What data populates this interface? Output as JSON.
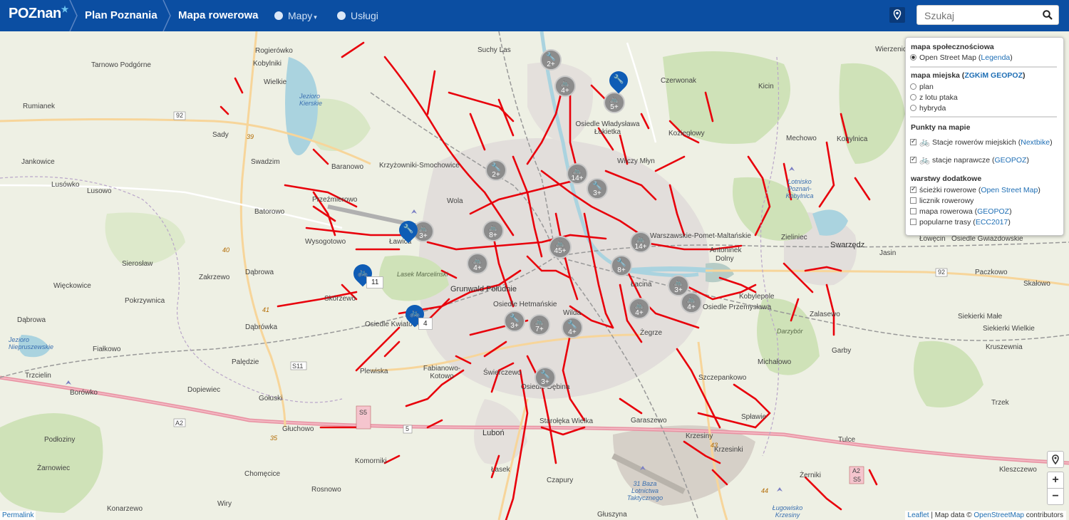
{
  "header": {
    "logo": "POZnan",
    "breadcrumb_1": "Plan Poznania",
    "breadcrumb_2": "Mapa rowerowa",
    "nav_maps": "Mapy",
    "nav_services": "Usługi",
    "search_placeholder": "Szukaj"
  },
  "layers_panel": {
    "community_heading": "mapa społecznościowa",
    "osm_label": "Open Street Map",
    "osm_legend": "Legenda",
    "city_heading": "mapa miejska",
    "city_source": "ZGKiM GEOPOZ",
    "city_options": [
      "plan",
      "z lotu ptaka",
      "hybryda"
    ],
    "points_heading": "Punkty na mapie",
    "points": [
      {
        "label": "Stacje rowerów miejskich",
        "source": "Nextbike",
        "checked": true
      },
      {
        "label": "stacje naprawcze",
        "source": "GEOPOZ",
        "checked": true
      }
    ],
    "extra_heading": "warstwy dodatkowe",
    "extras": [
      {
        "label": "ścieżki rowerowe",
        "source": "Open Street Map",
        "checked": true
      },
      {
        "label": "licznik rowerowy",
        "source": "",
        "checked": false
      },
      {
        "label": "mapa rowerowa",
        "source": "GEOPOZ",
        "checked": false
      },
      {
        "label": "popularne trasy",
        "source": "ECC2017",
        "checked": false
      }
    ]
  },
  "map": {
    "places": [
      {
        "name": "Rogierówko"
      },
      {
        "name": "Kobylniki"
      },
      {
        "name": "Wielkie"
      },
      {
        "name": "Tarnowo Podgórne"
      },
      {
        "name": "Rumianek"
      },
      {
        "name": "Sady"
      },
      {
        "name": "Jankowice"
      },
      {
        "name": "Swadzim"
      },
      {
        "name": "Lusówko"
      },
      {
        "name": "Lusowo"
      },
      {
        "name": "Krzyżowniki-Smochowice"
      },
      {
        "name": "Baranowo"
      },
      {
        "name": "Przeźmierowo"
      },
      {
        "name": "Batorowo"
      },
      {
        "name": "Wola"
      },
      {
        "name": "Wysogotowo"
      },
      {
        "name": "Ławica"
      },
      {
        "name": "Sierosław"
      },
      {
        "name": "Zakrzewo"
      },
      {
        "name": "Dąbrowa"
      },
      {
        "name": "Więckowice"
      },
      {
        "name": "Skórzewo"
      },
      {
        "name": "Pokrzywnica"
      },
      {
        "name": "Dąbrówka"
      },
      {
        "name": "Osiedle Kwiatowe"
      },
      {
        "name": "Grunwald Południe"
      },
      {
        "name": "Suchy Las"
      },
      {
        "name": "Osiedle Władysława Łokietka"
      },
      {
        "name": "Czerwonak"
      },
      {
        "name": "Kicin"
      },
      {
        "name": "Koziegłowy"
      },
      {
        "name": "Mechowo"
      },
      {
        "name": "Kobylnica"
      },
      {
        "name": "Wierzenica"
      },
      {
        "name": "Wilczy Młyn"
      },
      {
        "name": "Warszawskie-Pomet-Maltańskie"
      },
      {
        "name": "Antoninek"
      },
      {
        "name": "Dolny"
      },
      {
        "name": "Zieliniec"
      },
      {
        "name": "Swarzędz"
      },
      {
        "name": "Jasin"
      },
      {
        "name": "Łowęcin"
      },
      {
        "name": "Osiedle Gwiazdowskie"
      },
      {
        "name": "Paczkowo"
      },
      {
        "name": "Skałowo"
      },
      {
        "name": "Kobylepole"
      },
      {
        "name": "Osiedle Przemysława"
      },
      {
        "name": "Zalasewo"
      },
      {
        "name": "Garby"
      },
      {
        "name": "Siekierki Małe"
      },
      {
        "name": "Siekierki Wielkie"
      },
      {
        "name": "Kruszewnia"
      },
      {
        "name": "Osiedle Hetmańskie"
      },
      {
        "name": "Wilda"
      },
      {
        "name": "Żegrze"
      },
      {
        "name": "Łacina"
      },
      {
        "name": "Świerczewo"
      },
      {
        "name": "Fabianowo-Kotowo"
      },
      {
        "name": "Osiedle Dębina"
      },
      {
        "name": "Szczepankowo"
      },
      {
        "name": "Michałowo"
      },
      {
        "name": "Spławie"
      },
      {
        "name": "Garaszewo"
      },
      {
        "name": "Krzesiny"
      },
      {
        "name": "Krzesinki"
      },
      {
        "name": "Tulce"
      },
      {
        "name": "Trzek"
      },
      {
        "name": "Kleszczewo"
      },
      {
        "name": "Żerniki"
      },
      {
        "name": "Luboń"
      },
      {
        "name": "Starołęka Wielka"
      },
      {
        "name": "Łasek"
      },
      {
        "name": "Czapury"
      },
      {
        "name": "Głuszyna"
      },
      {
        "name": "Plewiska"
      },
      {
        "name": "Palędzie"
      },
      {
        "name": "Fiałkowo"
      },
      {
        "name": "Borówko"
      },
      {
        "name": "Dopiewiec"
      },
      {
        "name": "Gołuski"
      },
      {
        "name": "Głuchowo"
      },
      {
        "name": "Podłoziny"
      },
      {
        "name": "Żarnowiec"
      },
      {
        "name": "Komorniki"
      },
      {
        "name": "Chomęcice"
      },
      {
        "name": "Rosnowo"
      },
      {
        "name": "Wiry"
      },
      {
        "name": "Konarzewo"
      },
      {
        "name": "Dąbrowa"
      },
      {
        "name": "Trzcielin"
      },
      {
        "name": "Lasek Marcelinski"
      },
      {
        "name": "Jezioro Kierskie"
      },
      {
        "name": "Jezioro Niepruszewskie"
      },
      {
        "name": "Darzybór"
      },
      {
        "name": "31 Baza Lotnictwa Taktycznego"
      },
      {
        "name": "Ługowisko Krzesiny"
      },
      {
        "name": "Lotnisko Poznań-Kobylnica"
      }
    ],
    "road_labels": [
      "92",
      "39",
      "40",
      "41",
      "35",
      "S11",
      "A2",
      "S5",
      "5",
      "92",
      "A2",
      "S5",
      "43",
      "44"
    ],
    "clusters": [
      {
        "type": "repair",
        "count": "2+"
      },
      {
        "type": "bike",
        "count": "4+"
      },
      {
        "type": "bike",
        "count": "5+"
      },
      {
        "type": "repair",
        "count": "2+"
      },
      {
        "type": "bike",
        "count": "14+"
      },
      {
        "type": "repair",
        "count": "3+"
      },
      {
        "type": "bike",
        "count": "3+"
      },
      {
        "type": "bike",
        "count": "8+"
      },
      {
        "type": "bike",
        "count": "4+"
      },
      {
        "type": "bike",
        "count": "45+"
      },
      {
        "type": "repair",
        "count": "8+"
      },
      {
        "type": "bike",
        "count": "14+"
      },
      {
        "type": "bike",
        "count": "3+"
      },
      {
        "type": "bike",
        "count": "4+"
      },
      {
        "type": "bike",
        "count": "4+"
      },
      {
        "type": "repair",
        "count": "3+"
      },
      {
        "type": "bike",
        "count": "7+"
      },
      {
        "type": "repair",
        "count": "4+"
      },
      {
        "type": "repair",
        "count": "3+"
      }
    ],
    "pin_badges": [
      "11",
      "4"
    ]
  },
  "controls": {
    "zoom_in": "+",
    "zoom_out": "−",
    "permalink": "Permalink",
    "attribution_leaflet": "Leaflet",
    "attribution_text": "| Map data ©",
    "attribution_osm": "OpenStreetMap",
    "attribution_suffix": "contributors"
  },
  "colors": {
    "header": "#0b4ea2",
    "bike_path": "#e8000b",
    "cluster": "#8c8c8c",
    "pin": "#0f5cb5"
  }
}
